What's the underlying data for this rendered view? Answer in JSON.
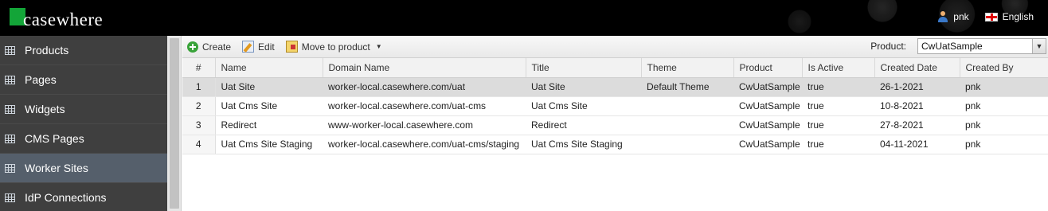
{
  "app": {
    "logo_text": "casewhere"
  },
  "header": {
    "user_name": "pnk",
    "language": "English"
  },
  "sidebar": {
    "items": [
      {
        "label": "Products",
        "active": false
      },
      {
        "label": "Pages",
        "active": false
      },
      {
        "label": "Widgets",
        "active": false
      },
      {
        "label": "CMS Pages",
        "active": false
      },
      {
        "label": "Worker Sites",
        "active": true
      },
      {
        "label": "IdP Connections",
        "active": false
      }
    ]
  },
  "toolbar": {
    "create_label": "Create",
    "edit_label": "Edit",
    "move_label": "Move to product",
    "product_label": "Product:",
    "product_value": "CwUatSample"
  },
  "table": {
    "columns": [
      "#",
      "Name",
      "Domain Name",
      "Title",
      "Theme",
      "Product",
      "Is Active",
      "Created Date",
      "Created By"
    ],
    "rows": [
      [
        "1",
        "Uat Site",
        "worker-local.casewhere.com/uat",
        "Uat Site",
        "Default Theme",
        "CwUatSample",
        "true",
        "26-1-2021",
        "pnk"
      ],
      [
        "2",
        "Uat Cms Site",
        "worker-local.casewhere.com/uat-cms",
        "Uat Cms Site",
        "",
        "CwUatSample",
        "true",
        "10-8-2021",
        "pnk"
      ],
      [
        "3",
        "Redirect",
        "www-worker-local.casewhere.com",
        "Redirect",
        "",
        "CwUatSample",
        "true",
        "27-8-2021",
        "pnk"
      ],
      [
        "4",
        "Uat Cms Site Staging",
        "worker-local.casewhere.com/uat-cms/staging",
        "Uat Cms Site Staging",
        "",
        "CwUatSample",
        "true",
        "04-11-2021",
        "pnk"
      ]
    ],
    "selected_row": 0
  }
}
